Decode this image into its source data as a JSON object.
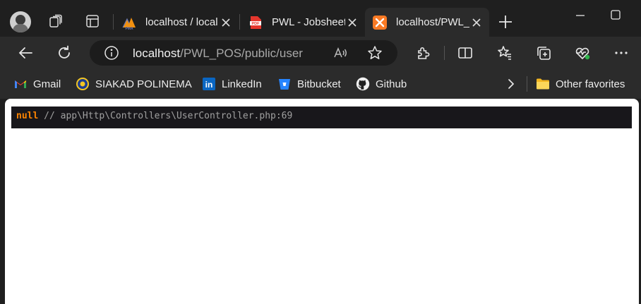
{
  "tabs": [
    {
      "title": "localhost / local",
      "favicon": "phpmyadmin-icon",
      "active": false
    },
    {
      "title": "PWL - Jobsheet",
      "favicon": "pdf-icon",
      "active": false
    },
    {
      "title": "localhost/PWL_",
      "favicon": "xampp-icon",
      "active": true
    }
  ],
  "address": {
    "host": "localhost",
    "path": "/PWL_POS/public/user"
  },
  "bookmarks": [
    {
      "label": "Gmail",
      "icon": "gmail-icon"
    },
    {
      "label": "SIAKAD POLINEMA",
      "icon": "polinema-icon"
    },
    {
      "label": "LinkedIn",
      "icon": "linkedin-icon"
    },
    {
      "label": "Bitbucket",
      "icon": "bitbucket-icon"
    },
    {
      "label": "Github",
      "icon": "github-icon"
    }
  ],
  "other_favorites": "Other favorites",
  "dump": {
    "value": "null",
    "comment": "// app\\Http\\Controllers\\UserController.php:69"
  },
  "colors": {
    "accent_orange": "#ff8400",
    "dump_background": "#18171b",
    "chrome_background": "#1f1f1f",
    "toolbar_background": "#2b2b2b"
  }
}
